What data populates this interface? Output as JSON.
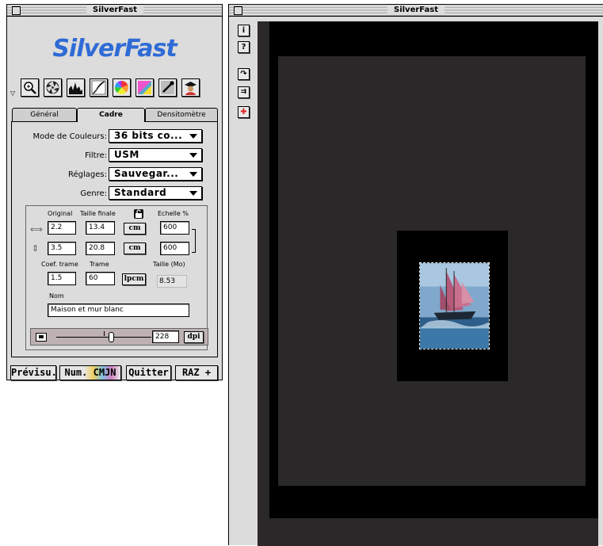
{
  "left_window": {
    "title": "SilverFast",
    "logo": "SilverFast",
    "tabs": [
      "Général",
      "Cadre",
      "Densitomètre"
    ],
    "active_tab": "Cadre",
    "settings": {
      "mode_label": "Mode de Couleurs:",
      "mode_value": "36 bits co...",
      "filter_label": "Filtre:",
      "filter_value": "USM",
      "reglages_label": "Réglages:",
      "reglages_value": "Sauvegar...",
      "genre_label": "Genre:",
      "genre_value": "Standard"
    },
    "dimensions": {
      "original_header": "Original",
      "taille_finale_header": "Taille finale",
      "echelle_header": "Echelle %",
      "width_original": "2.2",
      "width_final": "13.4",
      "width_unit": "cm",
      "width_scale": "600",
      "height_original": "3.5",
      "height_final": "20.8",
      "height_unit": "cm",
      "height_scale": "600",
      "coef_trame_label": "Coef. trame",
      "trame_label": "Trame",
      "taille_mo_label": "Taille (Mo)",
      "coef_trame_value": "1.5",
      "trame_value": "60",
      "trame_unit": "lpcm",
      "taille_mo_value": "8.53",
      "nom_label": "Nom",
      "nom_value": "Maison et mur blanc"
    },
    "resolution": {
      "value": "228",
      "unit": "dpi"
    },
    "buttons": {
      "preview": "Prévisu.",
      "scan": "Num. CMJN",
      "quit": "Quitter",
      "reset": "RAZ +"
    }
  },
  "right_window": {
    "title": "SilverFast",
    "side_buttons": [
      "i",
      "?"
    ]
  },
  "colors": {
    "logo_blue": "#2f6bd6",
    "preview_dark": "#2a2828",
    "window_gray": "#dcdcdc"
  },
  "icons": [
    "magnifier-icon",
    "aperture-icon",
    "histogram-icon",
    "gradation-curve-icon",
    "color-wheel-icon",
    "selective-color-icon",
    "pipette-icon",
    "expert-icon"
  ]
}
